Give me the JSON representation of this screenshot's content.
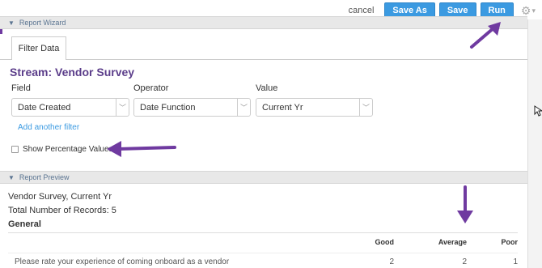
{
  "top": {
    "cancel": "cancel",
    "save_as": "Save As",
    "save": "Save",
    "run": "Run"
  },
  "wizard": {
    "header": "Report Wizard",
    "tab": "Filter Data",
    "stream_title": "Stream: Vendor Survey",
    "field_label": "Field",
    "operator_label": "Operator",
    "value_label": "Value",
    "field_value": "Date Created",
    "operator_value": "Date Function",
    "value_value": "Current Yr",
    "add_filter": "Add another filter",
    "show_percentage": "Show Percentage Values"
  },
  "preview": {
    "header": "Report Preview",
    "subtitle": "Vendor Survey, Current Yr",
    "records": "Total Number of Records: 5",
    "section": "General",
    "columns": [
      "Good",
      "Average",
      "Poor"
    ],
    "rows": [
      {
        "question": "Please rate your experience of coming onboard as a vendor",
        "values": [
          "2",
          "2",
          "1"
        ]
      }
    ]
  },
  "colors": {
    "accent_blue": "#3b9ae1",
    "title_purple": "#5b3d8a",
    "arrow_purple": "#6f3aa0"
  },
  "icons": [
    "gear-icon",
    "chevron-down-icon",
    "collapse-triangle-icon",
    "resize-cursor-icon"
  ]
}
